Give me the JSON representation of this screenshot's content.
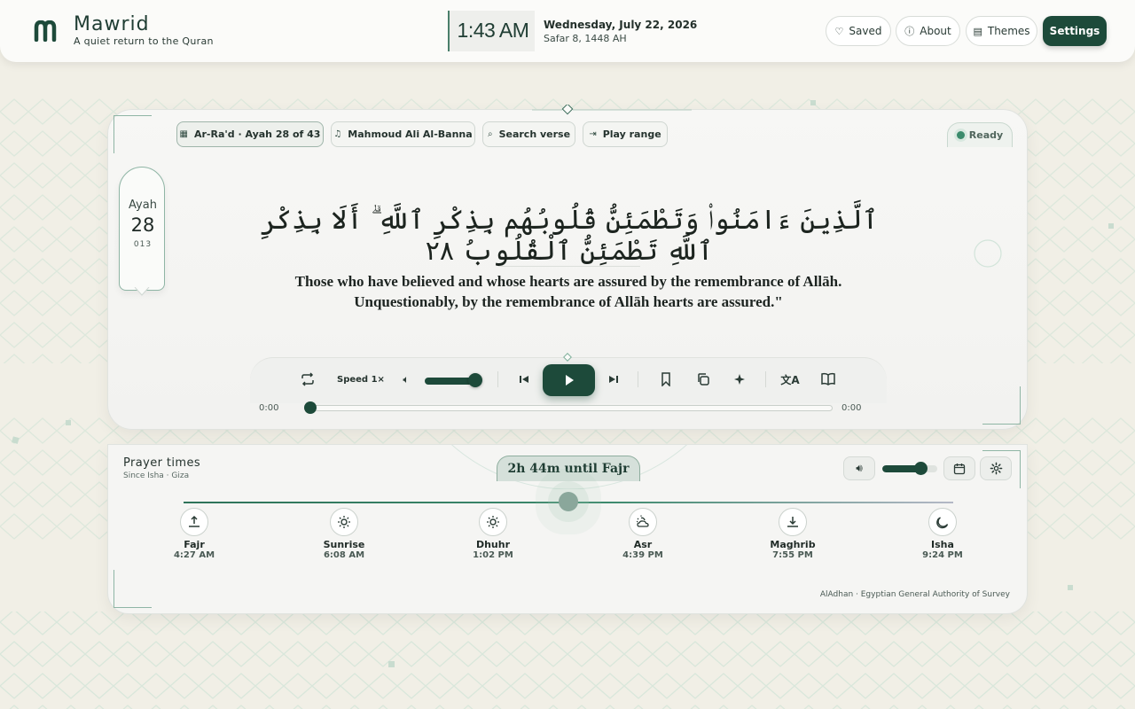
{
  "app": {
    "name": "Mawrid",
    "tagline": "A quiet return to the Quran"
  },
  "clock": {
    "time": "1:43 AM",
    "date": "Wednesday, July 22, 2026",
    "hijri": "Safar 8, 1448 AH"
  },
  "nav": {
    "saved": "Saved",
    "about": "About",
    "themes": "Themes",
    "settings": "Settings"
  },
  "reader": {
    "surah_chip": "Ar-Ra'd · Ayah 28 of 43",
    "reciter_chip": "Mahmoud Ali Al-Banna",
    "search_chip": "Search verse",
    "range_chip": "Play range",
    "status": "Ready",
    "ayah_label": "Ayah",
    "ayah_number": "28",
    "surah_number": "013",
    "arabic": "ٱلَّذِينَ ءَامَنُوا۟ وَتَطْمَئِنُّ قُلُوبُهُم بِذِكْرِ ٱللَّهِ ۗ أَلَا بِذِكْرِ ٱللَّهِ تَطْمَئِنُّ ٱلْقُلُوبُ ٢٨",
    "translation_line1": "Those who have believed and whose hearts are assured by the remembrance of Allāh.",
    "translation_line2": "Unquestionably, by the remembrance of Allāh hearts are assured.\""
  },
  "player": {
    "speed": "Speed 1×",
    "elapsed": "0:00",
    "duration": "0:00",
    "volume": 0.9,
    "progress": 0
  },
  "prayer": {
    "title": "Prayer times",
    "subtitle": "Since Isha · Giza",
    "countdown": "2h 44m until Fajr",
    "volume": 0.7,
    "times": [
      {
        "name": "Fajr",
        "time": "4:27 AM",
        "icon": "sunrise-arrow-icon"
      },
      {
        "name": "Sunrise",
        "time": "6:08 AM",
        "icon": "sun-icon"
      },
      {
        "name": "Dhuhr",
        "time": "1:02 PM",
        "icon": "sun-icon"
      },
      {
        "name": "Asr",
        "time": "4:39 PM",
        "icon": "sun-cloud-icon"
      },
      {
        "name": "Maghrib",
        "time": "7:55 PM",
        "icon": "sunset-arrow-icon"
      },
      {
        "name": "Isha",
        "time": "9:24 PM",
        "icon": "moon-icon"
      }
    ],
    "source": "AlAdhan · Egyptian General Authority of Survey"
  },
  "colors": {
    "accent": "#1d4a3a",
    "background": "#f1efe6",
    "ready": "#3c8b6c"
  }
}
